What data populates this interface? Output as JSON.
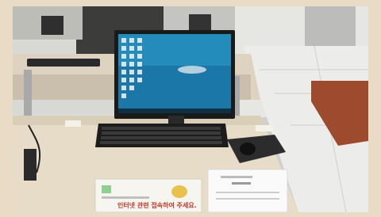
{
  "photo": {
    "subject": "computer-lab-desk",
    "sign_text": "인터넷 관련 접속하여 주세요.",
    "colors": {
      "frame": "#eadbc6",
      "desk": "#e7dcc7",
      "floor": "#e9e9e6",
      "wallpaper_blue": "#1b77a8"
    }
  }
}
